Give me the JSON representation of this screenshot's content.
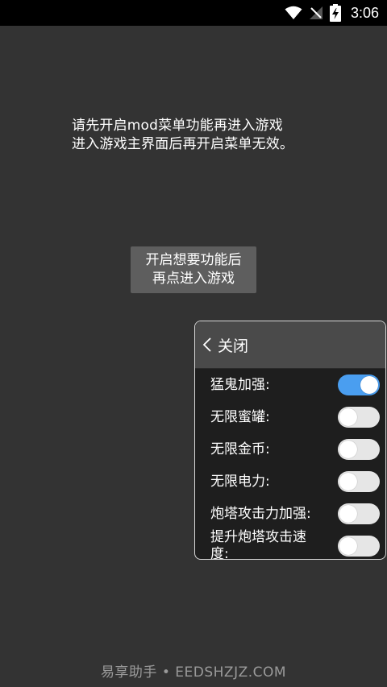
{
  "status": {
    "time": "3:06",
    "icons": [
      "wifi-icon",
      "no-signal-icon",
      "battery-charging-icon"
    ]
  },
  "notice": {
    "line1": "请先开启mod菜单功能再进入游戏",
    "line2": "进入游戏主界面后再开启菜单无效。"
  },
  "enter_button": {
    "line1": "开启想要功能后",
    "line2": "再点进入游戏"
  },
  "panel": {
    "close_label": "关闭",
    "options": [
      {
        "label": "猛鬼加强:",
        "on": true
      },
      {
        "label": "无限蜜罐:",
        "on": false
      },
      {
        "label": "无限金币:",
        "on": false
      },
      {
        "label": "无限电力:",
        "on": false
      },
      {
        "label": "炮塔攻击力加强:",
        "on": false
      },
      {
        "label": "提升炮塔攻击速度:",
        "on": false
      }
    ]
  },
  "watermark": "易享助手 • EEDSHZJZ.COM",
  "colors": {
    "background": "#333333",
    "toggle_on": "#4a9ef0",
    "toggle_off": "#e6e6e6"
  }
}
